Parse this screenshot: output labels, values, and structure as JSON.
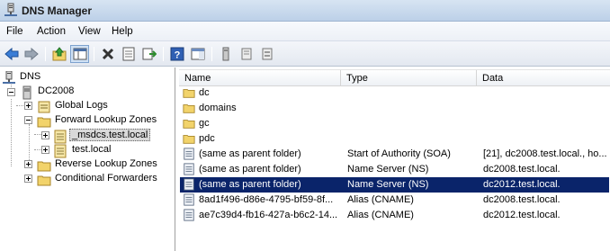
{
  "window": {
    "title": "DNS Manager"
  },
  "menu": [
    "File",
    "Action",
    "View",
    "Help"
  ],
  "toolbar": {
    "buttons": [
      "back-icon",
      "forward-icon",
      "up-folder-icon",
      "show-hide-tree-icon",
      "delete-icon",
      "properties-icon",
      "export-list-icon",
      "help-icon",
      "console-pane-icon",
      "server-icon",
      "zone-icon",
      "record-icon"
    ]
  },
  "tree": {
    "root": "DNS",
    "server": "DC2008",
    "global_logs": "Global Logs",
    "forward_zones": "Forward Lookup Zones",
    "msdcs": "_msdcs.test.local",
    "test_local": "test.local",
    "reverse_zones": "Reverse Lookup Zones",
    "conditional": "Conditional Forwarders"
  },
  "list": {
    "columns": [
      "Name",
      "Type",
      "Data"
    ],
    "rows": [
      {
        "kind": "folder",
        "name": "dc",
        "type": "",
        "data": ""
      },
      {
        "kind": "folder",
        "name": "domains",
        "type": "",
        "data": ""
      },
      {
        "kind": "folder",
        "name": "gc",
        "type": "",
        "data": ""
      },
      {
        "kind": "folder",
        "name": "pdc",
        "type": "",
        "data": ""
      },
      {
        "kind": "record",
        "name": "(same as parent folder)",
        "type": "Start of Authority (SOA)",
        "data": "[21], dc2008.test.local., ho..."
      },
      {
        "kind": "record",
        "name": "(same as parent folder)",
        "type": "Name Server (NS)",
        "data": "dc2008.test.local."
      },
      {
        "kind": "record",
        "name": "(same as parent folder)",
        "type": "Name Server (NS)",
        "data": "dc2012.test.local.",
        "selected": true
      },
      {
        "kind": "record",
        "name": "8ad1f496-d86e-4795-bf59-8f...",
        "type": "Alias (CNAME)",
        "data": "dc2008.test.local."
      },
      {
        "kind": "record",
        "name": "ae7c39d4-fb16-427a-b6c2-14...",
        "type": "Alias (CNAME)",
        "data": "dc2012.test.local."
      }
    ]
  },
  "colors": {
    "selection": "#0a246a",
    "titlebar": "#c9daee",
    "folder": "#f2d36b"
  }
}
